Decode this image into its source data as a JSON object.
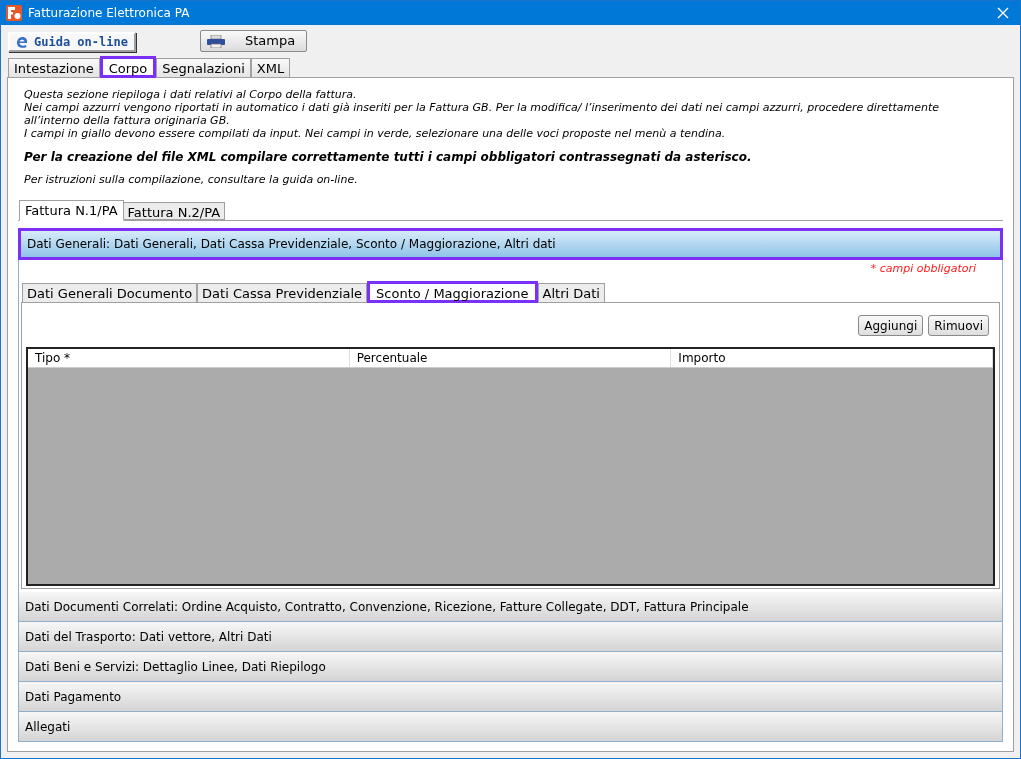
{
  "window": {
    "title": "Fatturazione Elettronica PA"
  },
  "toolbar": [
    {
      "label": "Guida on-line",
      "kind": "help"
    },
    {
      "label": "Stampa",
      "kind": "print"
    }
  ],
  "tabs": [
    {
      "label": "Intestazione",
      "selected": false
    },
    {
      "label": "Corpo",
      "selected": true
    },
    {
      "label": "Segnalazioni",
      "selected": false
    },
    {
      "label": "XML",
      "selected": false
    }
  ],
  "description": {
    "lines": [
      "Questa sezione riepiloga i dati relativi al Corpo della fattura.",
      "Nei campi azzurri vengono riportati in automatico i dati già inseriti per la Fattura GB. Per la modifica/ l’inserimento dei dati nei campi azzurri, procedere direttamente all’interno della fattura originaria GB.",
      "I campi in giallo devono essere compilati da input. Nei campi in verde, selezionare una delle voci proposte nel menù a tendina."
    ],
    "emphasis": "Per la creazione del file XML compilare correttamente tutti i campi obbligatori contrassegnati da asterisco.",
    "note": "Per istruzioni sulla compilazione, consultare la guida on-line."
  },
  "invoice_tabs": [
    {
      "label": "Fattura N.1/PA",
      "selected": true
    },
    {
      "label": "Fattura N.2/PA",
      "selected": false
    }
  ],
  "sections": [
    {
      "title": "Dati Generali: Dati Generali, Dati Cassa Previdenziale, Sconto / Maggiorazione, Altri dati",
      "expanded": true
    },
    {
      "title": "Dati Documenti Correlati: Ordine Acquisto, Contratto, Convenzione, Ricezione, Fatture Collegate, DDT, Fattura Principale",
      "expanded": false
    },
    {
      "title": "Dati del Trasporto: Dati vettore, Altri Dati",
      "expanded": false
    },
    {
      "title": "Dati Beni e Servizi: Dettaglio Linee, Dati Riepilogo",
      "expanded": false
    },
    {
      "title": "Dati Pagamento",
      "expanded": false
    },
    {
      "title": "Allegati",
      "expanded": false
    }
  ],
  "required_note": "* campi obbligatori",
  "sub_tabs": [
    {
      "label": "Dati Generali Documento",
      "selected": false
    },
    {
      "label": "Dati Cassa Previdenziale",
      "selected": false
    },
    {
      "label": "Sconto / Maggiorazione",
      "selected": true
    },
    {
      "label": "Altri Dati",
      "selected": false
    }
  ],
  "actions": [
    "Aggiungi",
    "Rimuovi"
  ],
  "table": {
    "columns": [
      "Tipo *",
      "Percentuale",
      "Importo"
    ]
  }
}
